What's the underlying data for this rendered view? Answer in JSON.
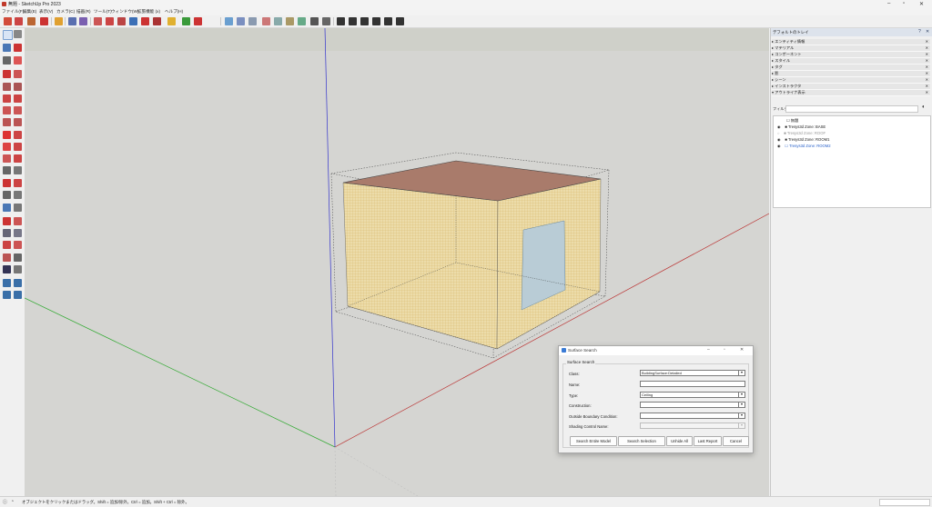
{
  "window": {
    "title": "無題 - SketchUp Pro 2023"
  },
  "menus": [
    "ファイル(F)",
    "編集(E)",
    "表示(V)",
    "カメラ(C)",
    "描画(R)",
    "ツール(T)",
    "ウィンドウ(W)",
    "拡張機能 (x)",
    "ヘルプ(H)"
  ],
  "tray": {
    "title": "デフォルトのトレイ",
    "sections": [
      "エンティティ情報",
      "マテリアル",
      "コンポーネント",
      "スタイル",
      "タグ",
      "影",
      "シーン",
      "インストラクタ",
      "アウトライナ表示"
    ],
    "filter_label": "フィルタ",
    "outliner": {
      "root": "無題",
      "items": [
        {
          "label": "Tresys3d Zone: BASE",
          "visible": true
        },
        {
          "label": "Tresys3d Zone: ROOF",
          "visible": false
        },
        {
          "label": "Tresys3d Zone: ROOM1",
          "visible": true
        },
        {
          "label": "Tresys3d Zone: ROOM2",
          "visible": true
        }
      ]
    }
  },
  "status": {
    "text": "オブジェクトをクリックまたはドラッグ。Shift = 追加/除外。Ctrl = 追加。Shift + Ctrl = 除外。"
  },
  "dialog": {
    "title": "Surface Search",
    "group_label": "Surface Search",
    "fields": [
      {
        "label": "Class:",
        "value": "BuildingSurface:Detailed",
        "kind": "dropdown"
      },
      {
        "label": "Name:",
        "value": "",
        "kind": "text"
      },
      {
        "label": "Type:",
        "value": "Ceiling",
        "kind": "dropdown"
      },
      {
        "label": "Construction:",
        "value": "",
        "kind": "dropdown"
      },
      {
        "label": "Outside Boundary Condition:",
        "value": "",
        "kind": "dropdown"
      },
      {
        "label": "Shading Control Name:",
        "value": "",
        "kind": "dropdown-disabled"
      }
    ],
    "buttons": {
      "search_entire": "Search Entire Model",
      "search_selection": "Search Selection",
      "unhide_all": "Unhide All",
      "last_report": "Last Report",
      "cancel": "Cancel"
    }
  },
  "colors": {
    "roof": "#a97b6b",
    "walls": "#e9d9a8",
    "window": "#b9ccd6",
    "axis_red": "#b33",
    "axis_green": "#3a3",
    "axis_blue": "#33c"
  }
}
